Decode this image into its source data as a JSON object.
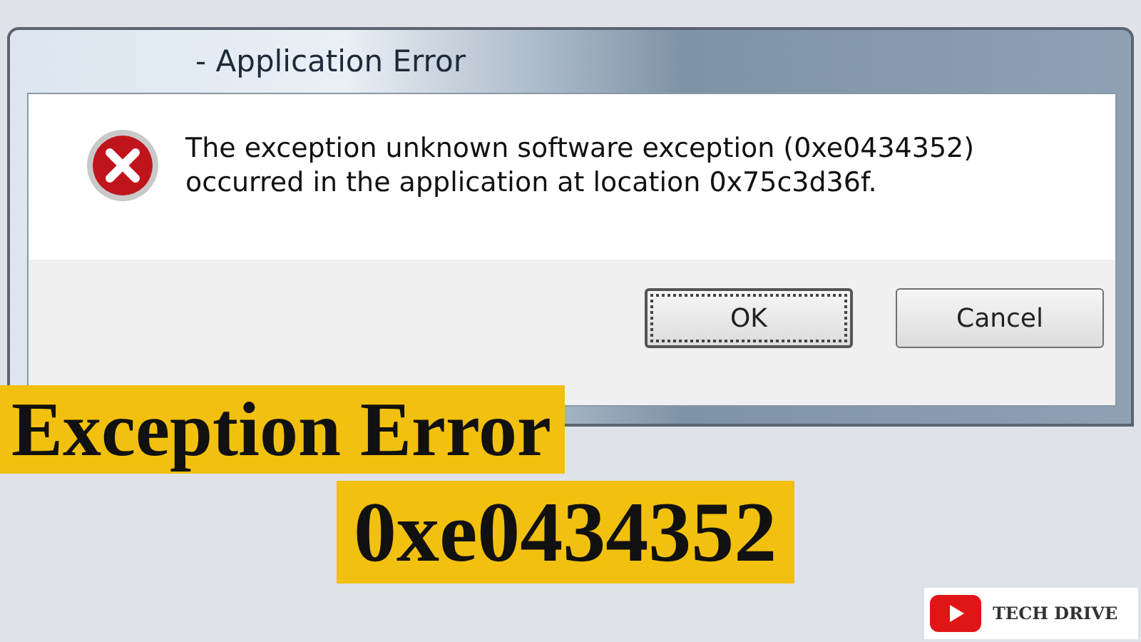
{
  "dialog": {
    "title": "- Application Error",
    "message": "The exception unknown software exception (0xe0434352) occurred in the application at location 0x75c3d36f.",
    "buttons": [
      {
        "label": "OK",
        "selected": true
      },
      {
        "label": "Cancel",
        "selected": false
      }
    ]
  },
  "banners": [
    "Exception Error",
    "0xe0434352"
  ],
  "channel": {
    "name": "TECH DRIVE"
  }
}
